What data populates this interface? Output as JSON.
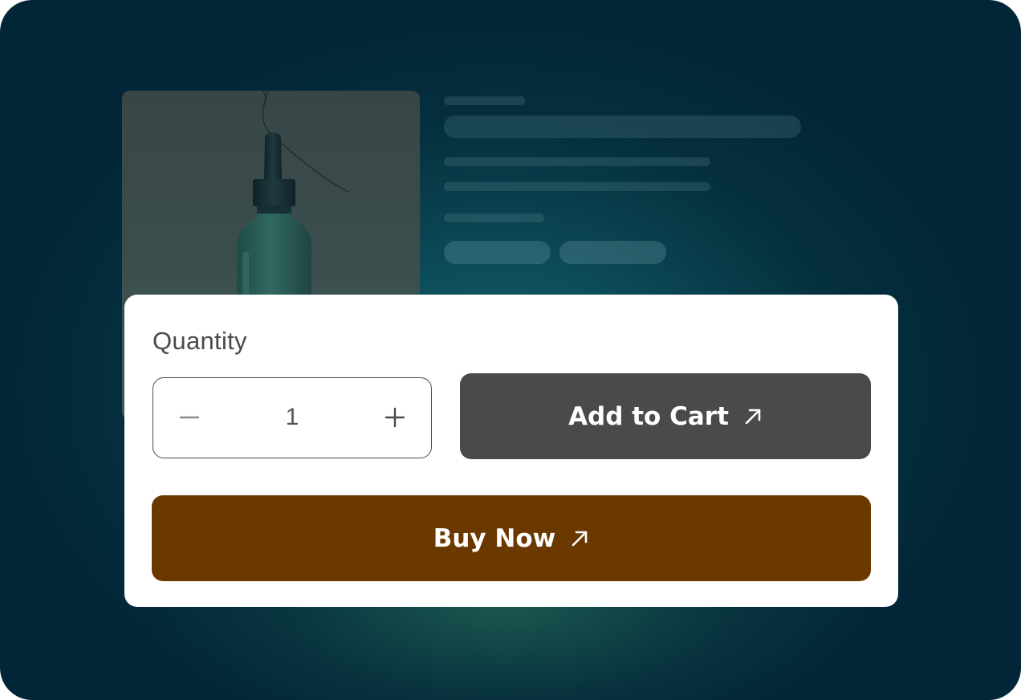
{
  "quantity": {
    "label": "Quantity",
    "value": "1",
    "decrement_icon": "minus-icon",
    "increment_icon": "plus-icon"
  },
  "actions": {
    "add_to_cart": {
      "label": "Add to Cart",
      "icon": "arrow-up-right-icon",
      "color": "#4a4a4a"
    },
    "buy_now": {
      "label": "Buy Now",
      "icon": "arrow-up-right-icon",
      "color": "#6b3900"
    }
  },
  "colors": {
    "background_dark": "#022638",
    "background_glow": "#12686f",
    "card": "#ffffff",
    "text": "#4a4a4a"
  }
}
